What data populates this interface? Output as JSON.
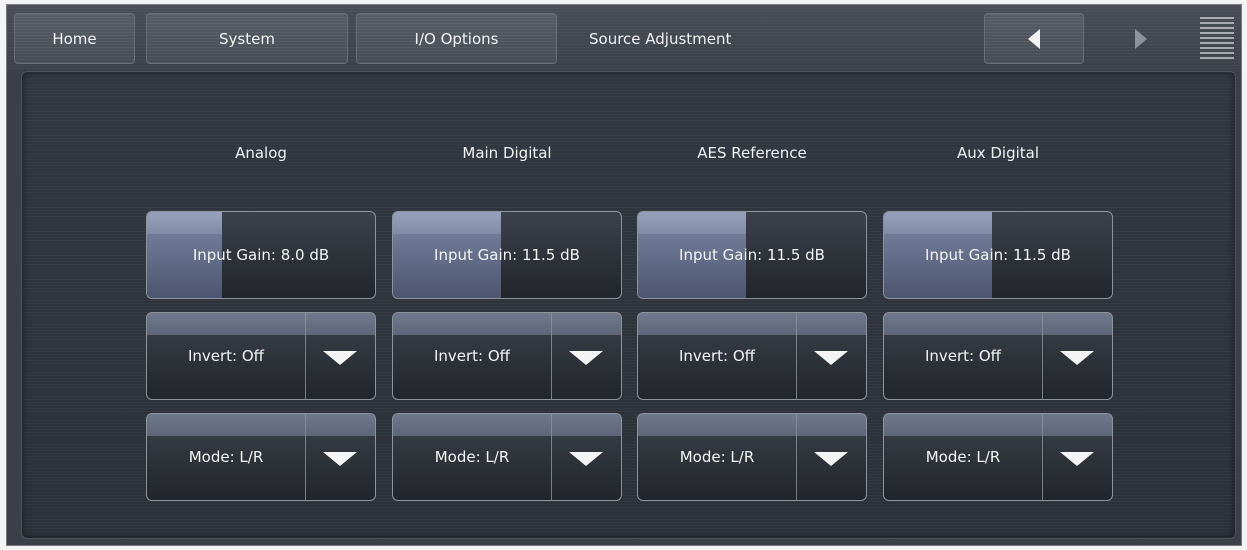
{
  "nav": {
    "home": "Home",
    "system": "System",
    "io_options": "I/O Options",
    "title": "Source Adjustment"
  },
  "icons": {
    "back": "left-arrow-icon",
    "forward": "right-arrow-icon",
    "menu": "menu-lines-icon"
  },
  "sources": [
    {
      "name": "Analog",
      "input_gain": "Input Gain: 8.0 dB",
      "gain_fill_fraction": 0.33,
      "invert": "Invert: Off",
      "mode": "Mode: L/R"
    },
    {
      "name": "Main Digital",
      "input_gain": "Input Gain: 11.5 dB",
      "gain_fill_fraction": 0.475,
      "invert": "Invert: Off",
      "mode": "Mode: L/R"
    },
    {
      "name": "AES Reference",
      "input_gain": "Input Gain: 11.5 dB",
      "gain_fill_fraction": 0.475,
      "invert": "Invert: Off",
      "mode": "Mode: L/R"
    },
    {
      "name": "Aux Digital",
      "input_gain": "Input Gain: 11.5 dB",
      "gain_fill_fraction": 0.475,
      "invert": "Invert: Off",
      "mode": "Mode: L/R"
    }
  ]
}
